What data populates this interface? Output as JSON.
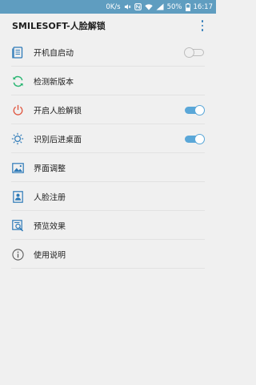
{
  "status_bar": {
    "net_speed": "0K/s",
    "battery": "50%",
    "time": "16:17",
    "icons": [
      "mute-icon",
      "nfc-icon",
      "wifi-icon",
      "signal-icon",
      "battery-icon"
    ]
  },
  "app_bar": {
    "title": "SMILESOFT-人脸解锁",
    "menu_icon": "overflow-menu-icon"
  },
  "items": [
    {
      "label": "开机自启动",
      "icon": "document-icon",
      "toggle": false
    },
    {
      "label": "检测新版本",
      "icon": "refresh-icon"
    },
    {
      "label": "开启人脸解锁",
      "icon": "power-icon",
      "toggle": true
    },
    {
      "label": "识别后进桌面",
      "icon": "brightness-icon",
      "toggle": true
    },
    {
      "label": "界面调整",
      "icon": "image-icon"
    },
    {
      "label": "人脸注册",
      "icon": "contact-card-icon"
    },
    {
      "label": "预览效果",
      "icon": "preview-icon"
    },
    {
      "label": "使用说明",
      "icon": "info-icon"
    }
  ],
  "colors": {
    "status_bar": "#5f9dc0",
    "accent": "#5aa7d8",
    "icon_blue": "#2d7ab8",
    "refresh_green": "#2bb673",
    "power_red": "#e0533c"
  }
}
